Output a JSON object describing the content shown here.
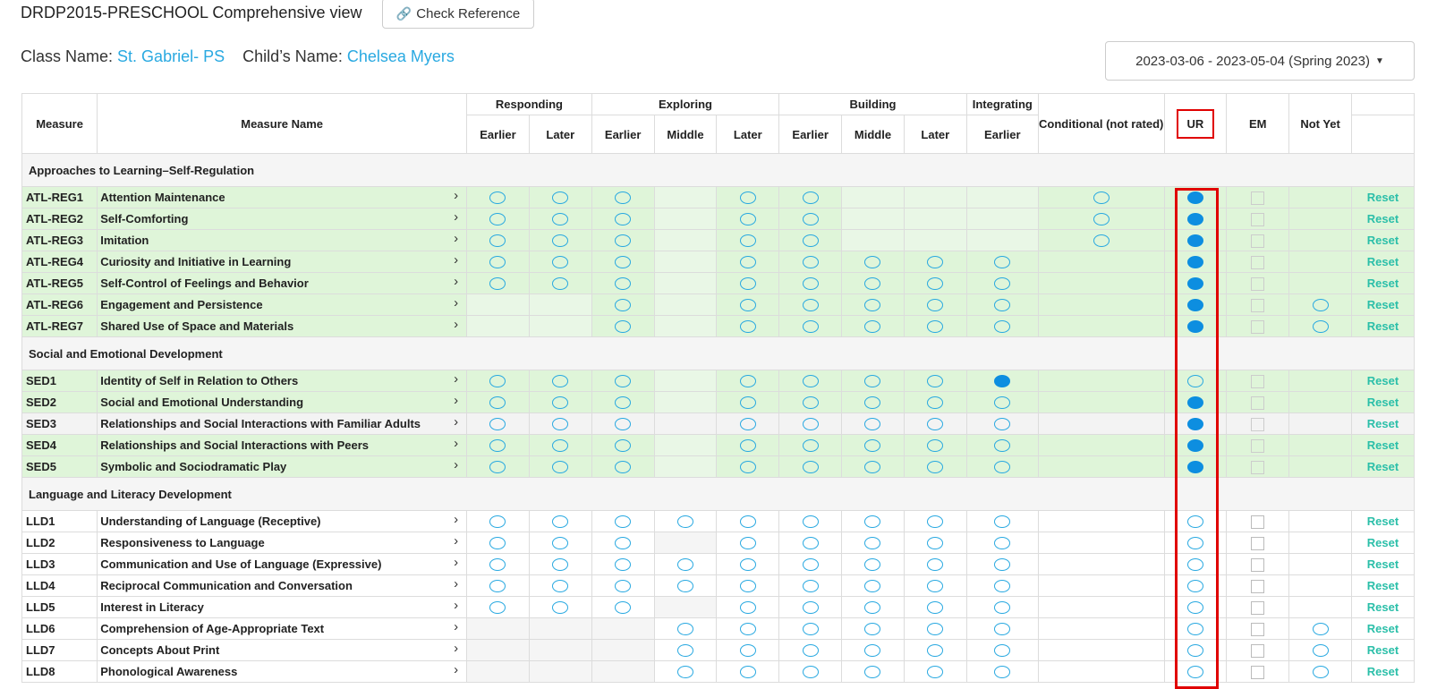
{
  "page": {
    "title": "DRDP2015-PRESCHOOL Comprehensive view",
    "check_reference": "Check Reference",
    "class_label": "Class Name:",
    "class_name": "St. Gabriel- PS",
    "child_label": "Child’s Name:",
    "child_name": "Chelsea Myers",
    "date_range": "2023-03-06 - 2023-05-04 (Spring 2023)"
  },
  "header": {
    "measure": "Measure",
    "measure_name": "Measure Name",
    "groups": [
      "Responding",
      "Exploring",
      "Building",
      "Integrating"
    ],
    "levels": [
      "Earlier",
      "Later",
      "Earlier",
      "Middle",
      "Later",
      "Earlier",
      "Middle",
      "Later",
      "Earlier"
    ],
    "conditional": "Conditional (not rated)",
    "ur": "UR",
    "em": "EM",
    "not_yet": "Not Yet"
  },
  "reset_label": "Reset",
  "sections": [
    {
      "title": "Approaches to Learning–Self-Regulation",
      "rows": [
        {
          "code": "ATL-REG1",
          "name": "Attention Maintenance",
          "levels": [
            1,
            1,
            1,
            -1,
            1,
            1,
            -1,
            -1,
            -1
          ],
          "cond": 1,
          "ur": 2,
          "notyet": 0,
          "bg": "g"
        },
        {
          "code": "ATL-REG2",
          "name": "Self-Comforting",
          "levels": [
            1,
            1,
            1,
            -1,
            1,
            1,
            -1,
            -1,
            -1
          ],
          "cond": 1,
          "ur": 2,
          "notyet": 0,
          "bg": "g"
        },
        {
          "code": "ATL-REG3",
          "name": "Imitation",
          "levels": [
            1,
            1,
            1,
            -1,
            1,
            1,
            -1,
            -1,
            -1
          ],
          "cond": 1,
          "ur": 2,
          "notyet": 0,
          "bg": "g"
        },
        {
          "code": "ATL-REG4",
          "name": "Curiosity and Initiative in Learning",
          "levels": [
            1,
            1,
            1,
            -1,
            1,
            1,
            1,
            1,
            1
          ],
          "cond": 0,
          "ur": 2,
          "notyet": 0,
          "bg": "g"
        },
        {
          "code": "ATL-REG5",
          "name": "Self-Control of Feelings and Behavior",
          "levels": [
            1,
            1,
            1,
            -1,
            1,
            1,
            1,
            1,
            1
          ],
          "cond": 0,
          "ur": 2,
          "notyet": 0,
          "bg": "g"
        },
        {
          "code": "ATL-REG6",
          "name": "Engagement and Persistence",
          "levels": [
            -1,
            -1,
            1,
            -1,
            1,
            1,
            1,
            1,
            1
          ],
          "cond": 0,
          "ur": 2,
          "notyet": 1,
          "bg": "g"
        },
        {
          "code": "ATL-REG7",
          "name": "Shared Use of Space and Materials",
          "levels": [
            -1,
            -1,
            1,
            -1,
            1,
            1,
            1,
            1,
            1
          ],
          "cond": 0,
          "ur": 2,
          "notyet": 1,
          "bg": "g"
        }
      ]
    },
    {
      "title": "Social and Emotional Development",
      "rows": [
        {
          "code": "SED1",
          "name": "Identity of Self in Relation to Others",
          "levels": [
            1,
            1,
            1,
            -1,
            1,
            1,
            1,
            1,
            2
          ],
          "cond": 0,
          "ur": 1,
          "notyet": 0,
          "bg": "g"
        },
        {
          "code": "SED2",
          "name": "Social and Emotional Understanding",
          "levels": [
            1,
            1,
            1,
            -1,
            1,
            1,
            1,
            1,
            1
          ],
          "cond": 0,
          "ur": 2,
          "notyet": 0,
          "bg": "g"
        },
        {
          "code": "SED3",
          "name": "Relationships and Social Interactions with Familiar Adults",
          "levels": [
            1,
            1,
            1,
            -1,
            1,
            1,
            1,
            1,
            1
          ],
          "cond": 0,
          "ur": 2,
          "notyet": 0,
          "bg": "gy"
        },
        {
          "code": "SED4",
          "name": "Relationships and Social Interactions with Peers",
          "levels": [
            1,
            1,
            1,
            -1,
            1,
            1,
            1,
            1,
            1
          ],
          "cond": 0,
          "ur": 2,
          "notyet": 0,
          "bg": "g"
        },
        {
          "code": "SED5",
          "name": "Symbolic and Sociodramatic Play",
          "levels": [
            1,
            1,
            1,
            -1,
            1,
            1,
            1,
            1,
            1
          ],
          "cond": 0,
          "ur": 2,
          "notyet": 0,
          "bg": "g"
        }
      ]
    },
    {
      "title": "Language and Literacy Development",
      "rows": [
        {
          "code": "LLD1",
          "name": "Understanding of Language (Receptive)",
          "levels": [
            1,
            1,
            1,
            1,
            1,
            1,
            1,
            1,
            1
          ],
          "cond": 0,
          "ur": 1,
          "notyet": 0,
          "bg": "w"
        },
        {
          "code": "LLD2",
          "name": "Responsiveness to Language",
          "levels": [
            1,
            1,
            1,
            -1,
            1,
            1,
            1,
            1,
            1
          ],
          "cond": 0,
          "ur": 1,
          "notyet": 0,
          "bg": "w"
        },
        {
          "code": "LLD3",
          "name": "Communication and Use of Language (Expressive)",
          "levels": [
            1,
            1,
            1,
            1,
            1,
            1,
            1,
            1,
            1
          ],
          "cond": 0,
          "ur": 1,
          "notyet": 0,
          "bg": "w"
        },
        {
          "code": "LLD4",
          "name": "Reciprocal Communication and Conversation",
          "levels": [
            1,
            1,
            1,
            1,
            1,
            1,
            1,
            1,
            1
          ],
          "cond": 0,
          "ur": 1,
          "notyet": 0,
          "bg": "w"
        },
        {
          "code": "LLD5",
          "name": "Interest in Literacy",
          "levels": [
            1,
            1,
            1,
            -1,
            1,
            1,
            1,
            1,
            1
          ],
          "cond": 0,
          "ur": 1,
          "notyet": 0,
          "bg": "w"
        },
        {
          "code": "LLD6",
          "name": "Comprehension of Age-Appropriate Text",
          "levels": [
            -1,
            -1,
            -1,
            1,
            1,
            1,
            1,
            1,
            1
          ],
          "cond": 0,
          "ur": 1,
          "notyet": 1,
          "bg": "w"
        },
        {
          "code": "LLD7",
          "name": "Concepts About Print",
          "levels": [
            -1,
            -1,
            -1,
            1,
            1,
            1,
            1,
            1,
            1
          ],
          "cond": 0,
          "ur": 1,
          "notyet": 1,
          "bg": "w"
        },
        {
          "code": "LLD8",
          "name": "Phonological Awareness",
          "levels": [
            -1,
            -1,
            -1,
            1,
            1,
            1,
            1,
            1,
            1
          ],
          "cond": 0,
          "ur": 1,
          "notyet": 1,
          "bg": "w"
        }
      ]
    }
  ]
}
